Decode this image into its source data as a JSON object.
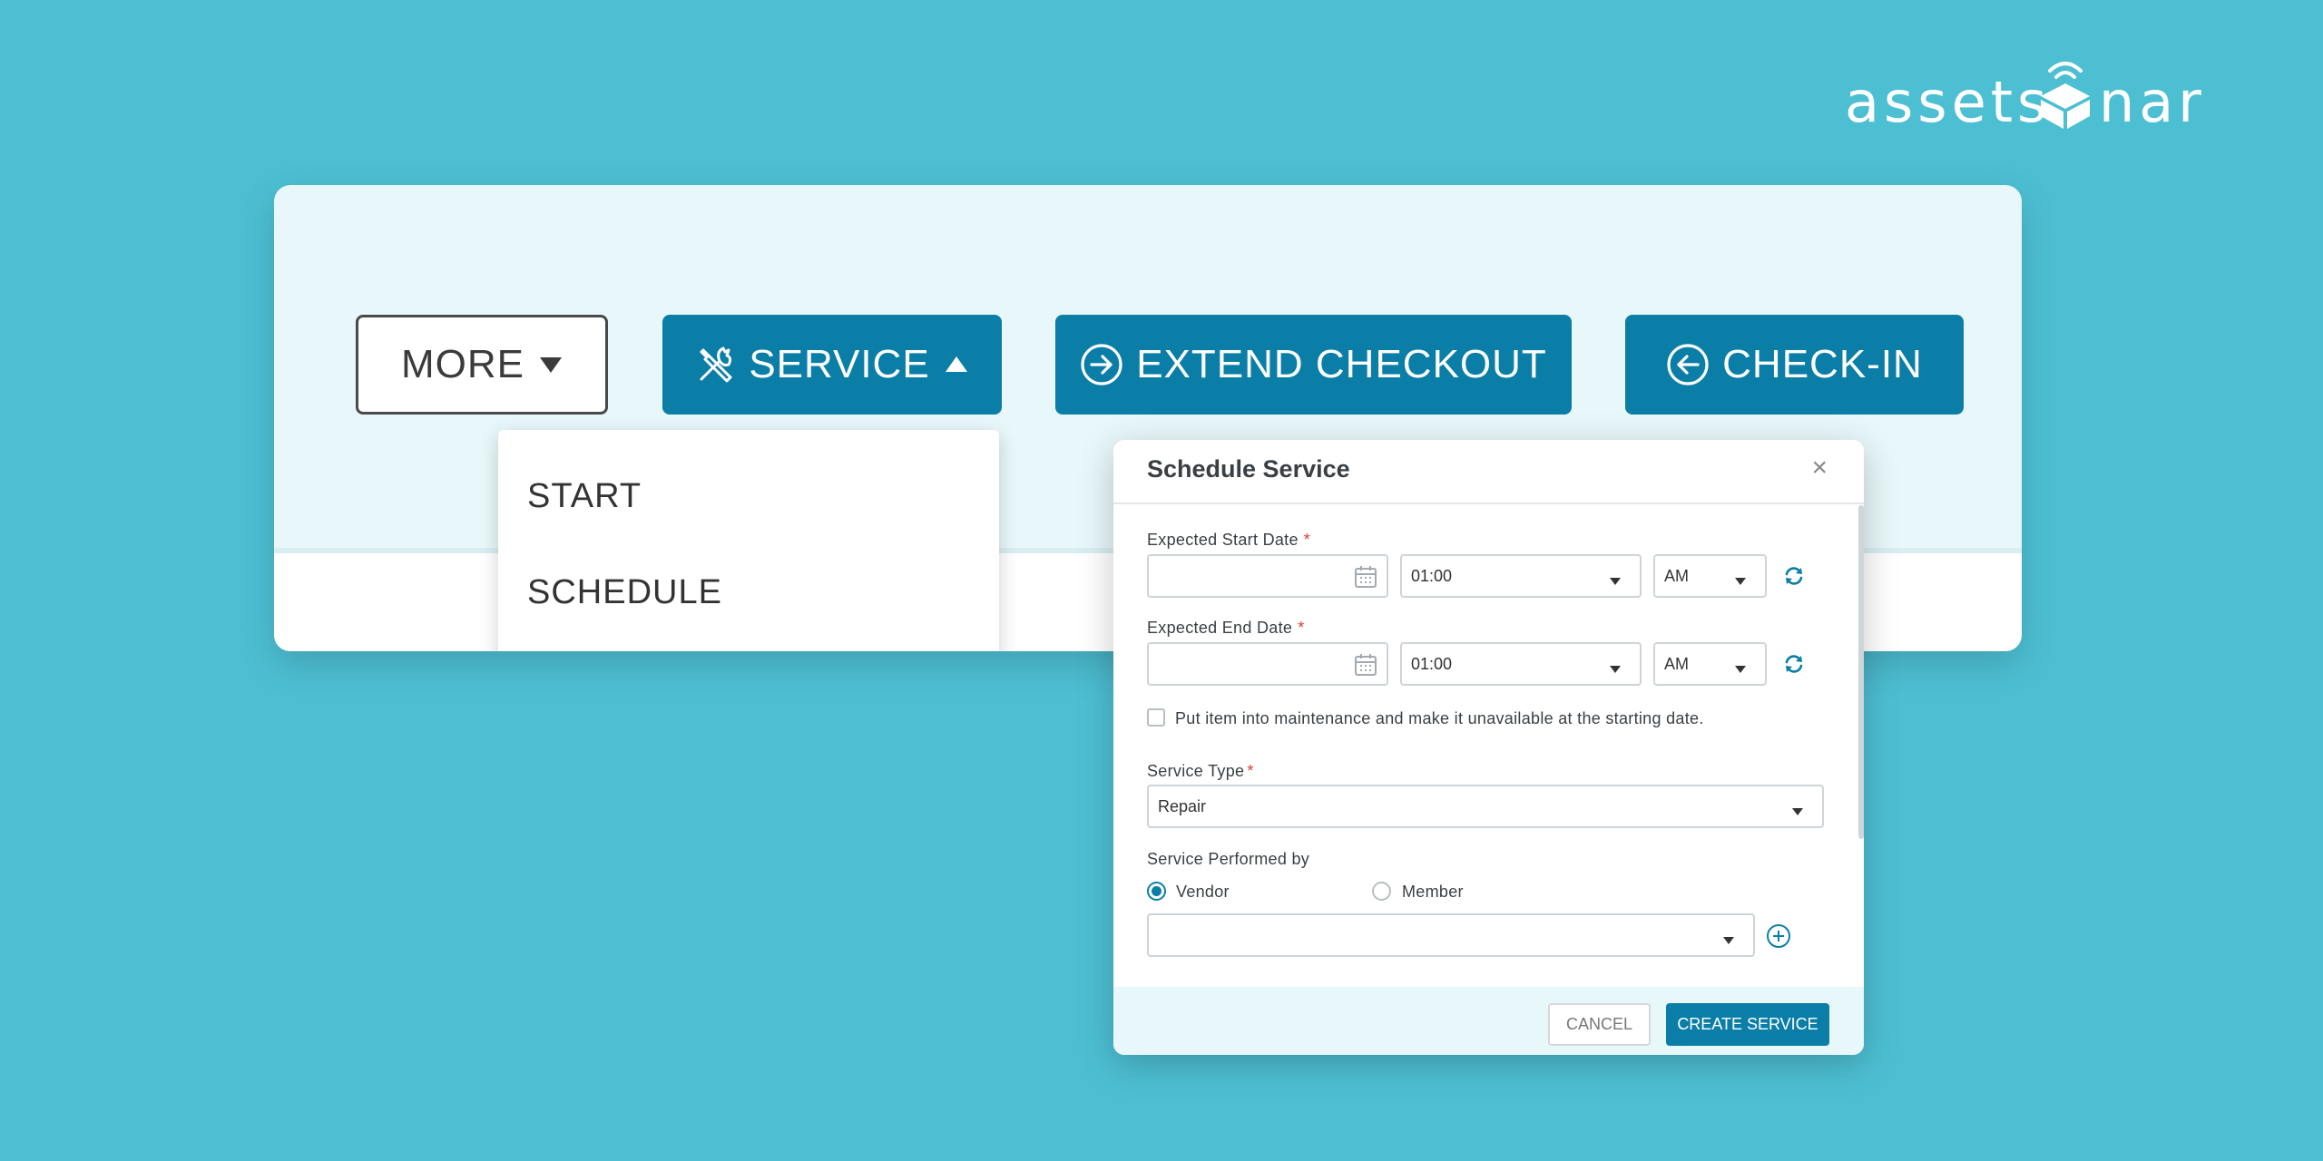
{
  "logo": {
    "left": "assets",
    "right": "nar"
  },
  "toolbar": {
    "more_label": "MORE",
    "service_label": "SERVICE",
    "extend_label": "EXTEND CHECKOUT",
    "checkin_label": "CHECK-IN"
  },
  "dropdown": {
    "items": [
      {
        "label": "START"
      },
      {
        "label": "SCHEDULE"
      }
    ]
  },
  "modal": {
    "title": "Schedule Service",
    "close": "×",
    "start_date": {
      "label": "Expected Start Date",
      "required": "*",
      "value": "",
      "time": "01:00",
      "ampm": "AM"
    },
    "end_date": {
      "label": "Expected End Date",
      "required": "*",
      "value": "",
      "time": "01:00",
      "ampm": "AM"
    },
    "maintenance_text": "Put item into maintenance and make it unavailable at the starting date.",
    "service_type": {
      "label": "Service Type",
      "required": "*",
      "value": "Repair"
    },
    "performed_by": {
      "label": "Service Performed by",
      "options": [
        "Vendor",
        "Member"
      ],
      "selected": "Vendor",
      "vendor_value": ""
    },
    "cancel_label": "CANCEL",
    "create_label": "CREATE SERVICE"
  },
  "colors": {
    "background": "#4dbfd3",
    "primary": "#0a7ea7",
    "card": "#e8f7fa",
    "required": "#e53935"
  }
}
